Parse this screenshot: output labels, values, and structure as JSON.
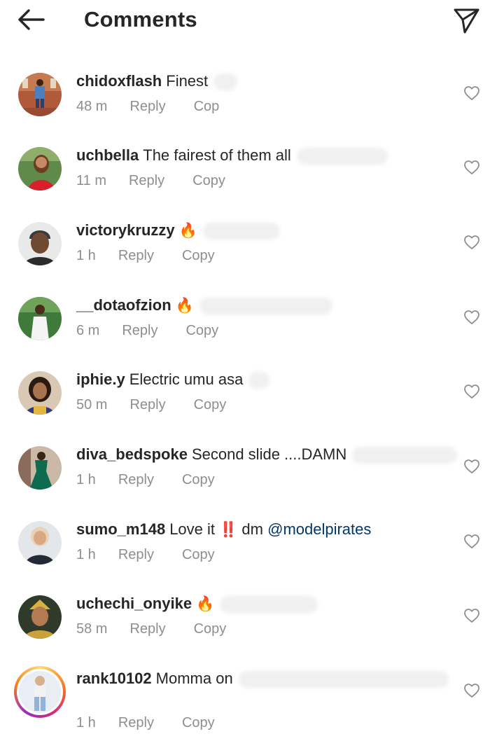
{
  "header": {
    "title": "Comments",
    "back_icon": "arrow-left-icon",
    "share_icon": "paper-plane-icon"
  },
  "actions": {
    "reply_label": "Reply",
    "copy_label": "Copy"
  },
  "comments": [
    {
      "username": "chidoxflash",
      "text": "Finest",
      "time": "48 m",
      "copy_label": "Cop"
    },
    {
      "username": "uchbella",
      "text": "The fairest of them all",
      "time": "11 m"
    },
    {
      "username": "victorykruzzy",
      "text": "🔥",
      "time": "1 h"
    },
    {
      "username": "__dotaofzion",
      "text": "🔥",
      "time": "6 m"
    },
    {
      "username": "iphie.y",
      "text": "Electric umu asa",
      "time": "50 m"
    },
    {
      "username": "diva_bedspoke",
      "text": "Second slide ....DAMN",
      "time": "1 h"
    },
    {
      "username": "sumo_m148",
      "text": "Love it",
      "emoji": "‼️",
      "text2": "dm",
      "mention": "@modelpirates",
      "time": "1 h"
    },
    {
      "username": "uchechi_onyike",
      "text": "🔥",
      "time": "58 m"
    },
    {
      "username": "rank10102",
      "text": "Momma on",
      "time": "1 h",
      "has_story": true
    }
  ],
  "colors": {
    "text": "#262626",
    "secondary": "#8e8e8e",
    "mention": "#00376b",
    "background": "#ffffff"
  }
}
